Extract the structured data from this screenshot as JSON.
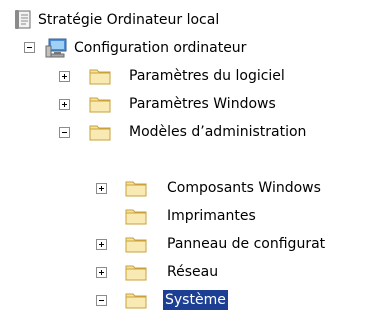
{
  "tree": {
    "root": {
      "label": "Stratégie Ordinateur local",
      "icon": "policy-document-icon"
    },
    "computer_config": {
      "label": "Configuration ordinateur",
      "icon": "computer-icon",
      "state": "expanded"
    },
    "software_settings": {
      "label": "Paramètres du logiciel",
      "icon": "folder-icon",
      "state": "collapsed"
    },
    "windows_settings": {
      "label": "Paramètres Windows",
      "icon": "folder-icon",
      "state": "collapsed"
    },
    "admin_templates": {
      "label": "Modèles d’administration",
      "icon": "folder-icon",
      "state": "expanded"
    },
    "windows_components": {
      "label": "Composants Windows",
      "icon": "folder-icon",
      "state": "collapsed"
    },
    "printers": {
      "label": "Imprimantes",
      "icon": "folder-icon",
      "state": "leaf"
    },
    "control_panel": {
      "label": "Panneau de configurat",
      "icon": "folder-icon",
      "state": "collapsed"
    },
    "network": {
      "label": "Réseau",
      "icon": "folder-icon",
      "state": "collapsed"
    },
    "system": {
      "label": "Système",
      "icon": "folder-icon",
      "state": "expanded",
      "selected": true
    }
  },
  "colors": {
    "selection_bg": "#1c3f94",
    "folder_fill": "#f6e29b",
    "folder_stroke": "#c9a13a"
  }
}
